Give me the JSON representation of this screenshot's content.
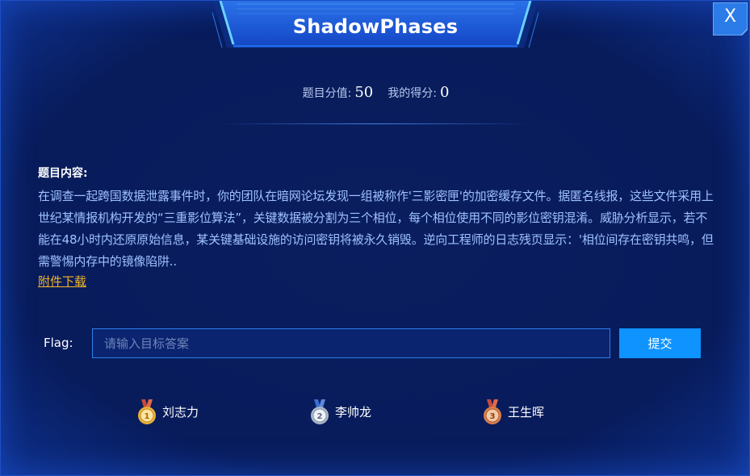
{
  "title": "ShadowPhases",
  "close_label": "X",
  "score": {
    "value_label": "题目分值:",
    "value": "50",
    "my_score_label": "我的得分:",
    "my_score": "0"
  },
  "content": {
    "heading": "题目内容:",
    "body": "在调查一起跨国数据泄露事件时，你的团队在暗网论坛发现一组被称作'三影密匣'的加密缓存文件。据匿名线报，这些文件采用上世纪某情报机构开发的“三重影位算法”，关键数据被分割为三个相位，每个相位使用不同的影位密钥混淆。威胁分析显示，若不能在48小时内还原原始信息，某关键基础设施的访问密钥将被永久销毁。逆向工程师的日志残页显示：'相位间存在密钥共鸣，但需警惕内存中的镜像陷阱..",
    "download_label": "附件下载"
  },
  "flag": {
    "label": "Flag:",
    "placeholder": "请输入目标答案",
    "value": "",
    "submit_label": "提交"
  },
  "winners": [
    {
      "rank": "1",
      "name": "刘志力",
      "medal_icon": "gold-medal-icon"
    },
    {
      "rank": "2",
      "name": "李帅龙",
      "medal_icon": "silver-medal-icon"
    },
    {
      "rank": "3",
      "name": "王生晖",
      "medal_icon": "bronze-medal-icon"
    }
  ],
  "colors": {
    "background": "#0a1f5e",
    "accent": "#0f93ff",
    "link": "#f0b429",
    "body_text": "#9fc1ff",
    "gold": "#f2c14e",
    "silver": "#c9d3e3",
    "bronze": "#e59a6a"
  }
}
